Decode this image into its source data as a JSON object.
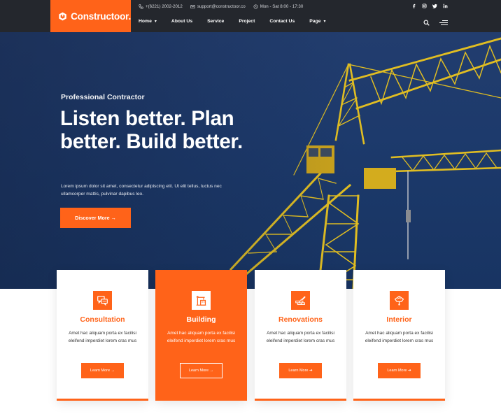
{
  "brand": {
    "name": "Constructoor.",
    "accent": "#ff6319",
    "dark": "#24272d"
  },
  "topbar": {
    "phone": "+(6221) 2002-2012",
    "email": "support@constructoor.co",
    "hours": "Mon - Sat 8:00 - 17:30",
    "socials": [
      "facebook-icon",
      "instagram-icon",
      "twitter-icon",
      "linkedin-icon"
    ]
  },
  "nav": {
    "items": [
      {
        "label": "Home",
        "dropdown": true
      },
      {
        "label": "About Us",
        "dropdown": false
      },
      {
        "label": "Service",
        "dropdown": false
      },
      {
        "label": "Project",
        "dropdown": false
      },
      {
        "label": "Contact Us",
        "dropdown": false
      },
      {
        "label": "Page",
        "dropdown": true
      }
    ],
    "chevron": "⌄"
  },
  "hero": {
    "eyebrow": "Professional Contractor",
    "headline": "Listen better. Plan better. Build better.",
    "lead": "Lorem ipsum dolor sit amet, consectetur adipiscing elit. Ut elit tellus, luctus nec ullamcorper mattis, pulvinar dapibus leo.",
    "cta": "Discover More →"
  },
  "services": [
    {
      "title": "Consultation",
      "text": "Amet hac aliquam porta ex facilisi eleifend imperdiet lorem cras mus",
      "button": "Learn More →",
      "icon": "chat-bubbles-icon",
      "active": false
    },
    {
      "title": "Building",
      "text": "Amet hac aliquam porta ex facilisi eleifend imperdiet lorem cras mus",
      "button": "Learn More →",
      "icon": "crane-building-icon",
      "active": true
    },
    {
      "title": "Renovations",
      "text": "Amet hac aliquam porta ex facilisi eleifend imperdiet lorem cras mus",
      "button": "Learn More ➔",
      "icon": "brick-trowel-icon",
      "active": false
    },
    {
      "title": "Interior",
      "text": "Amet hac aliquam porta ex facilisi eleifend imperdiet lorem cras mus",
      "button": "Learn More ➔",
      "icon": "lamp-icon",
      "active": false
    }
  ]
}
